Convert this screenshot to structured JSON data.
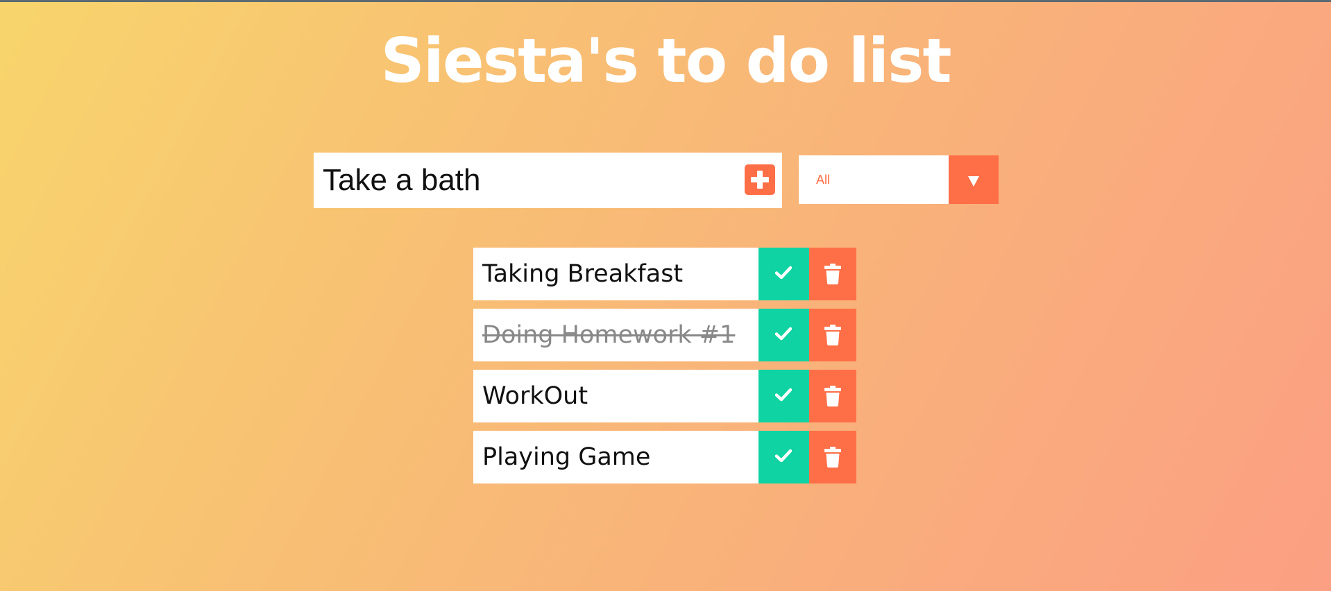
{
  "page": {
    "title": "Siesta's to do list"
  },
  "form": {
    "input_value": "Take a bath",
    "add_icon": "plus-square-icon"
  },
  "filter": {
    "selected": "All",
    "arrow_icon": "caret-down-icon"
  },
  "todos": [
    {
      "text": "Taking Breakfast",
      "completed": false
    },
    {
      "text": "Doing Homework #1",
      "completed": true
    },
    {
      "text": "WorkOut",
      "completed": false
    },
    {
      "text": "Playing Game",
      "completed": false
    }
  ],
  "icons": {
    "complete": "check-icon",
    "delete": "trash-icon"
  },
  "colors": {
    "accent": "#ff6f47",
    "complete": "#0fd3a3",
    "gradient_start": "#f8d56c",
    "gradient_end": "#fc9f83"
  }
}
